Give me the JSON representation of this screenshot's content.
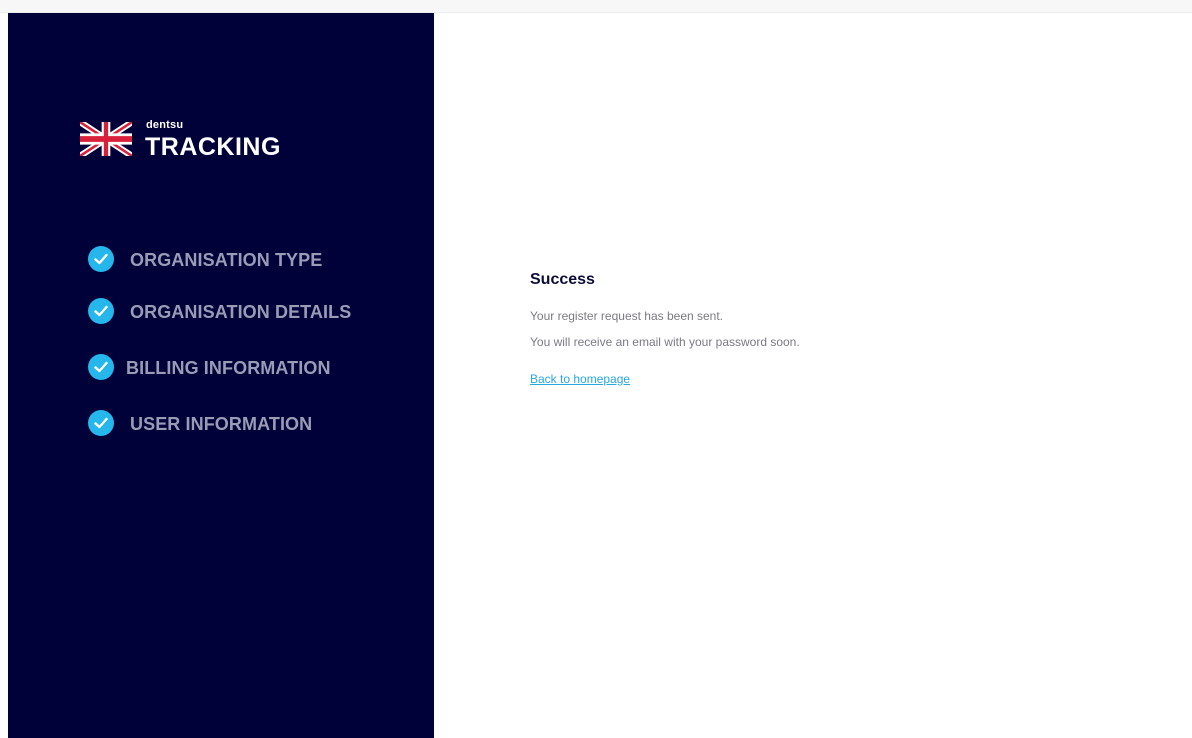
{
  "brand": {
    "small": "dentsu",
    "big": "TRACKING",
    "flag_icon": "uk-flag-icon"
  },
  "colors": {
    "sidebar_bg": "#01013a",
    "check_bg": "#25b6ec",
    "step_text": "#9a9cb6",
    "link": "#27a8de"
  },
  "steps": [
    {
      "label": "ORGANISATION TYPE",
      "icon": "check-circle-icon",
      "completed": true
    },
    {
      "label": "ORGANISATION DETAILS",
      "icon": "check-circle-icon",
      "completed": true
    },
    {
      "label": "BILLING INFORMATION",
      "icon": "check-circle-icon",
      "completed": true
    },
    {
      "label": "USER INFORMATION",
      "icon": "check-circle-icon",
      "completed": true
    }
  ],
  "message": {
    "title": "Success",
    "line1": "Your register request has been sent.",
    "line2": "You will receive an email with your password soon.",
    "link": "Back to homepage"
  }
}
